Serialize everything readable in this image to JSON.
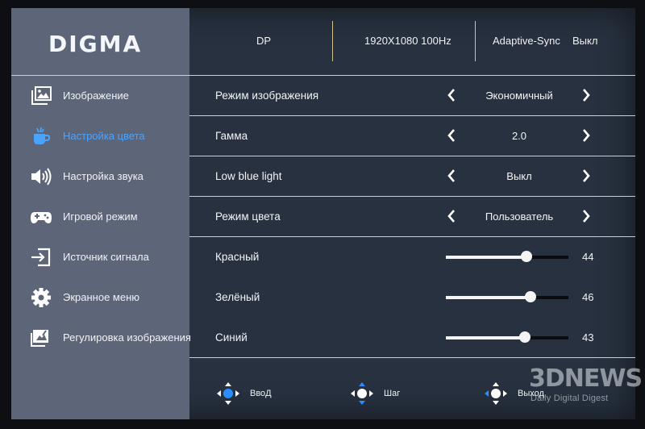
{
  "brand": "DIGMA",
  "top_bar": {
    "input": "DP",
    "resolution": "1920X1080 100Hz",
    "sync_label": "Adaptive-Sync",
    "sync_value": "Выкл"
  },
  "sidebar": {
    "items": [
      {
        "label": "Изображение",
        "icon": "image-icon",
        "active": false
      },
      {
        "label": "Настройка цвета",
        "icon": "color-cup-icon",
        "active": true
      },
      {
        "label": "Настройка звука",
        "icon": "speaker-icon",
        "active": false
      },
      {
        "label": "Игровой режим",
        "icon": "gamepad-icon",
        "active": false
      },
      {
        "label": "Источник сигнала",
        "icon": "input-source-icon",
        "active": false
      },
      {
        "label": "Экранное меню",
        "icon": "gear-icon",
        "active": false
      },
      {
        "label": "Регулировка изображения",
        "icon": "image-adjust-icon",
        "active": false
      }
    ],
    "active_color": "#4aa3ff"
  },
  "settings": {
    "picture_mode": {
      "label": "Режим изображения",
      "value": "Экономичный"
    },
    "gamma": {
      "label": "Гамма",
      "value": "2.0"
    },
    "low_blue_light": {
      "label": "Low blue light",
      "value": "Выкл"
    },
    "color_mode": {
      "label": "Режим цвета",
      "value": "Пользователь"
    },
    "red": {
      "label": "Красный",
      "value": "44",
      "level": 44
    },
    "green": {
      "label": "Зелёный",
      "value": "46",
      "level": 46
    },
    "blue": {
      "label": "Синий",
      "value": "43",
      "level": 43
    }
  },
  "footer": {
    "enter": "ВвоД",
    "step": "Шаг",
    "exit": "Выход"
  },
  "watermark": {
    "brand": "3DNEWS",
    "tagline": "Daily Digital Digest"
  }
}
